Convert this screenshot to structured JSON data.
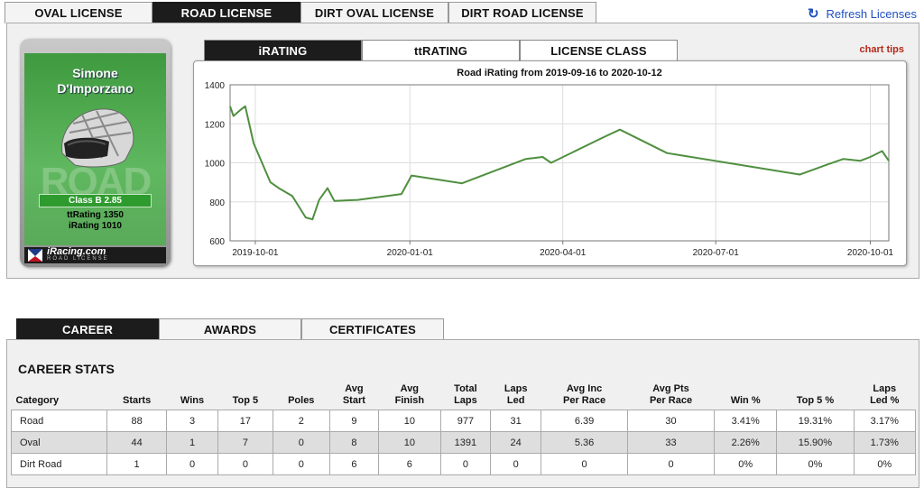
{
  "license_tabs": [
    {
      "label": "OVAL LICENSE",
      "active": false
    },
    {
      "label": "ROAD LICENSE",
      "active": true
    },
    {
      "label": "DIRT OVAL LICENSE",
      "active": false
    },
    {
      "label": "DIRT ROAD LICENSE",
      "active": false
    }
  ],
  "refresh_label": "Refresh Licenses",
  "card": {
    "name_line1": "Simone",
    "name_line2": "D'Imporzano",
    "watermark": "ROAD",
    "class_label": "Class B 2.85",
    "ttrating": "ttRating 1350",
    "irating": "iRating 1010",
    "logo_main": "iRacing.com",
    "logo_sub": "ROAD LICENSE",
    "color": "#4aa64a"
  },
  "chart_tabs": [
    {
      "label": "iRATING",
      "active": true
    },
    {
      "label": "ttRATING",
      "active": false
    },
    {
      "label": "LICENSE CLASS",
      "active": false
    }
  ],
  "chart_tips": "chart tips",
  "chart_data": {
    "type": "line",
    "title": "Road iRating from 2019-09-16 to 2020-10-12",
    "xlabel": "",
    "ylabel": "",
    "ylim": [
      600,
      1400
    ],
    "yticks": [
      600,
      800,
      1000,
      1200,
      1400
    ],
    "xlim": [
      "2019-09-16",
      "2020-10-12"
    ],
    "xticks": [
      "2019-10-01",
      "2020-01-01",
      "2020-04-01",
      "2020-07-01",
      "2020-10-01"
    ],
    "grid": true,
    "line_color": "#4f8f3f",
    "series": [
      {
        "name": "",
        "x": [
          "2019-09-16",
          "2019-09-18",
          "2019-09-22",
          "2019-09-25",
          "2019-09-30",
          "2019-10-10",
          "2019-10-15",
          "2019-10-23",
          "2019-10-31",
          "2019-11-04",
          "2019-11-08",
          "2019-11-13",
          "2019-11-17",
          "2019-12-01",
          "2019-12-27",
          "2020-01-02",
          "2020-02-01",
          "2020-03-10",
          "2020-03-20",
          "2020-03-25",
          "2020-04-25",
          "2020-05-05",
          "2020-06-02",
          "2020-08-20",
          "2020-09-05",
          "2020-09-15",
          "2020-09-25",
          "2020-10-01",
          "2020-10-08",
          "2020-10-12"
        ],
        "values": [
          1290,
          1240,
          1270,
          1290,
          1100,
          900,
          870,
          830,
          720,
          710,
          810,
          870,
          805,
          810,
          840,
          935,
          895,
          1020,
          1030,
          1000,
          1130,
          1170,
          1050,
          940,
          990,
          1020,
          1010,
          1030,
          1060,
          1010
        ]
      }
    ]
  },
  "career_tabs": [
    {
      "label": "CAREER",
      "active": true
    },
    {
      "label": "AWARDS",
      "active": false
    },
    {
      "label": "CERTIFICATES",
      "active": false
    }
  ],
  "career_title": "CAREER STATS",
  "career_table": {
    "headers": [
      [
        "Category"
      ],
      [
        "Starts"
      ],
      [
        "Wins"
      ],
      [
        "Top 5"
      ],
      [
        "Poles"
      ],
      [
        "Avg",
        "Start"
      ],
      [
        "Avg",
        "Finish"
      ],
      [
        "Total",
        "Laps"
      ],
      [
        "Laps",
        "Led"
      ],
      [
        "Avg Inc",
        "Per Race"
      ],
      [
        "Avg Pts",
        "Per Race"
      ],
      [
        "Win %"
      ],
      [
        "Top 5 %"
      ],
      [
        "Laps",
        "Led %"
      ]
    ],
    "rows": [
      [
        "Road",
        "88",
        "3",
        "17",
        "2",
        "9",
        "10",
        "977",
        "31",
        "6.39",
        "30",
        "3.41%",
        "19.31%",
        "3.17%"
      ],
      [
        "Oval",
        "44",
        "1",
        "7",
        "0",
        "8",
        "10",
        "1391",
        "24",
        "5.36",
        "33",
        "2.26%",
        "15.90%",
        "1.73%"
      ],
      [
        "Dirt Road",
        "1",
        "0",
        "0",
        "0",
        "6",
        "6",
        "0",
        "0",
        "0",
        "0",
        "0%",
        "0%",
        "0%"
      ]
    ]
  }
}
